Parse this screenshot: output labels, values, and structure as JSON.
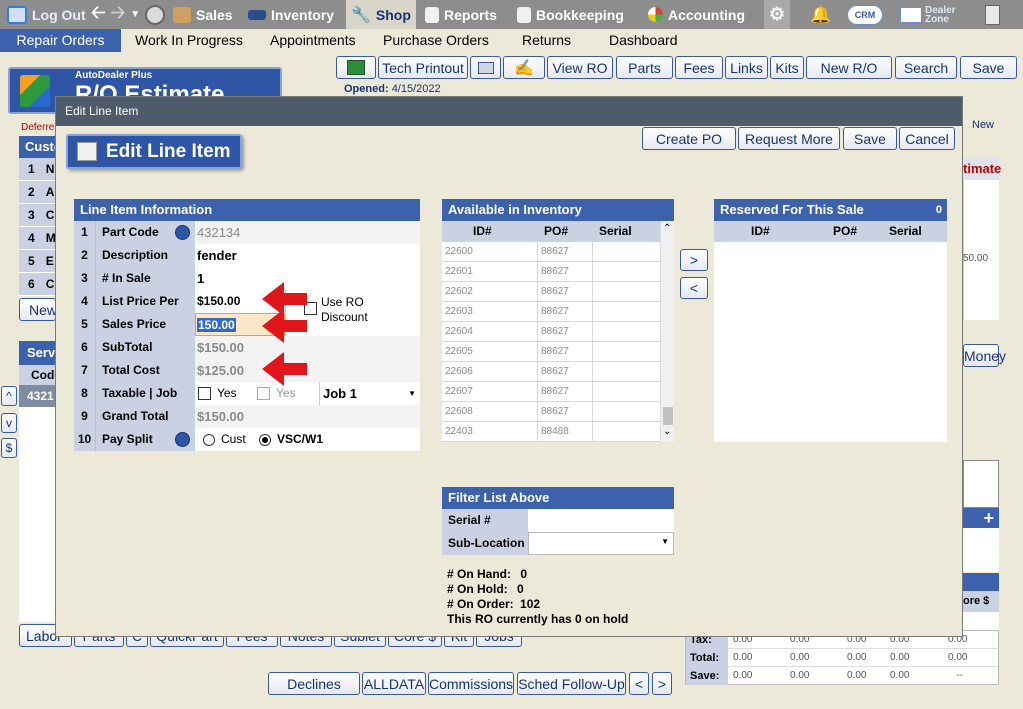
{
  "topbar": {
    "logout": "Log Out",
    "tabs": [
      {
        "label": "Sales",
        "icon": "sales-icon"
      },
      {
        "label": "Inventory",
        "icon": "car-icon"
      },
      {
        "label": "Shop",
        "icon": "wrench-icon"
      },
      {
        "label": "Reports",
        "icon": "report-icon"
      },
      {
        "label": "Bookkeeping",
        "icon": "book-icon"
      },
      {
        "label": "Accounting",
        "icon": "pie-chart-icon"
      }
    ],
    "crm": "CRM",
    "dealer_zone_1": "Dealer",
    "dealer_zone_2": "Zone"
  },
  "subnav": [
    "Repair Orders",
    "Work In Progress",
    "Appointments",
    "Purchase Orders",
    "Returns",
    "Dashboard"
  ],
  "toolbar": [
    "Tech Printout",
    "View RO",
    "Parts",
    "Fees",
    "Links",
    "Kits",
    "New R/O",
    "Search",
    "Save"
  ],
  "header": {
    "brand": "AutoDealer Plus",
    "title": "R/O Estimate",
    "opened_label": "Opened:",
    "opened_date": "4/15/2022",
    "deferred": "Deferre",
    "new": "New"
  },
  "underlay": {
    "customer": "Custo",
    "rows": [
      {
        "n": "1",
        "t": "N"
      },
      {
        "n": "2",
        "t": "A"
      },
      {
        "n": "3",
        "t": "C"
      },
      {
        "n": "4",
        "t": "M"
      },
      {
        "n": "5",
        "t": "E"
      },
      {
        "n": "6",
        "t": "C"
      }
    ],
    "new_btn": "New",
    "services": "Serv",
    "code": "Code",
    "code_val": "4321",
    "side_up": "^",
    "side_v": "v",
    "side_dollar": "$",
    "estimate": "timate",
    "amount": "50.00",
    "money": "Money",
    "more": "ore $",
    "plus": "+",
    "bottom_tabs": [
      "Labor",
      "Parts",
      "C",
      "QuickPart",
      "Fees",
      "Notes",
      "Sublet",
      "Core $",
      "Kit",
      "Jobs"
    ],
    "totals": [
      {
        "label": "Tax:",
        "v": [
          "0.00",
          "0.00",
          "0.00",
          "0.00",
          "0.00"
        ]
      },
      {
        "label": "Total:",
        "v": [
          "0.00",
          "0.00",
          "0.00",
          "0.00",
          "0.00"
        ]
      },
      {
        "label": "Save:",
        "v": [
          "0.00",
          "0.00",
          "0.00",
          "0.00",
          "--"
        ]
      }
    ],
    "footer_btns": [
      "Declines",
      "ALLDATA",
      "Commissions",
      "Sched Follow-Up",
      "<",
      ">"
    ]
  },
  "modal": {
    "title": "Edit Line Item",
    "heading": "Edit Line Item",
    "buttons": [
      "Create PO",
      "Request More",
      "Save",
      "Cancel"
    ],
    "line_info": {
      "header": "Line Item Information",
      "rows": [
        {
          "n": "1",
          "label": "Part Code",
          "value": "432134"
        },
        {
          "n": "2",
          "label": "Description",
          "value": "fender"
        },
        {
          "n": "3",
          "label": "# In Sale",
          "value": "1"
        },
        {
          "n": "4",
          "label": "List Price Per",
          "value": "$150.00"
        },
        {
          "n": "5",
          "label": "Sales Price",
          "value": "150.00"
        },
        {
          "n": "6",
          "label": "SubTotal",
          "value": "$150.00"
        },
        {
          "n": "7",
          "label": "Total Cost",
          "value": "$125.00"
        },
        {
          "n": "8",
          "label": "Taxable | Job",
          "value": ""
        },
        {
          "n": "9",
          "label": "Grand Total",
          "value": "$150.00"
        },
        {
          "n": "10",
          "label": "Pay Split",
          "value": ""
        }
      ],
      "use_ro_1": "Use RO",
      "use_ro_2": "Discount",
      "yes1": "Yes",
      "yes2": "Yes",
      "job": "Job 1",
      "cust": "Cust",
      "vsc": "VSC/W1"
    },
    "inventory": {
      "header": "Available in Inventory",
      "cols": [
        "ID#",
        "PO#",
        "Serial"
      ],
      "rows": [
        {
          "id": "22600",
          "po": "88627"
        },
        {
          "id": "22601",
          "po": "88627"
        },
        {
          "id": "22602",
          "po": "88627"
        },
        {
          "id": "22603",
          "po": "88627"
        },
        {
          "id": "22604",
          "po": "88627"
        },
        {
          "id": "22605",
          "po": "88627"
        },
        {
          "id": "22606",
          "po": "88627"
        },
        {
          "id": "22607",
          "po": "88627"
        },
        {
          "id": "22608",
          "po": "88627"
        },
        {
          "id": "22403",
          "po": "88488"
        }
      ]
    },
    "move_right": ">",
    "move_left": "<",
    "reserved": {
      "header": "Reserved For This Sale",
      "count": "0",
      "cols": [
        "ID#",
        "PO#",
        "Serial"
      ]
    },
    "filter": {
      "header": "Filter List Above",
      "serial_label": "Serial #",
      "subloc_label": "Sub-Location"
    },
    "stats": {
      "on_hand_label": "# On Hand:",
      "on_hand": "0",
      "on_hold_label": "# On Hold:",
      "on_hold": "0",
      "on_order_label": "# On Order:",
      "on_order": "102",
      "note": "This RO currently has 0 on hold"
    }
  }
}
